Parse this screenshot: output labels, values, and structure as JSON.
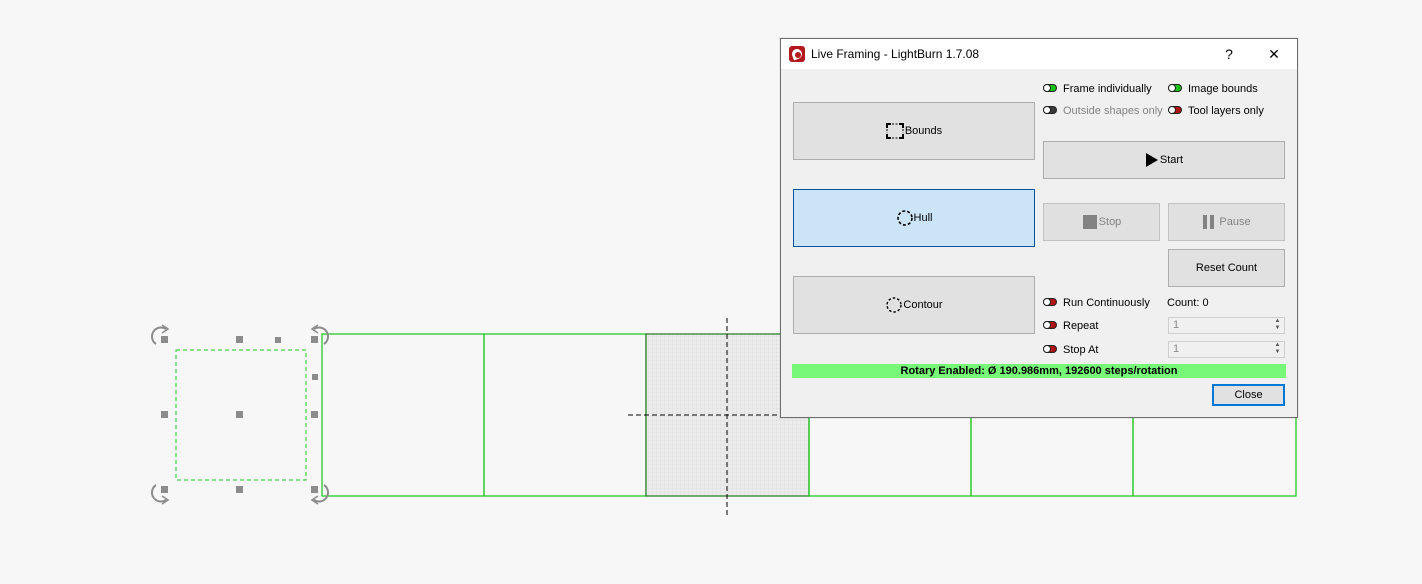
{
  "window": {
    "title": "Live Framing - LightBurn 1.7.08",
    "help_label": "?",
    "close_label": "✕"
  },
  "modes": [
    {
      "label": "Bounds",
      "icon": "bounds-icon",
      "selected": false
    },
    {
      "label": "Hull",
      "icon": "hull-icon",
      "selected": true
    },
    {
      "label": "Contour",
      "icon": "contour-icon",
      "selected": false
    }
  ],
  "options": {
    "frame_individually": {
      "label": "Frame individually",
      "state": "on"
    },
    "image_bounds": {
      "label": "Image bounds",
      "state": "on"
    },
    "outside_shapes_only": {
      "label": "Outside shapes only",
      "state": "off",
      "disabled": true
    },
    "tool_layers_only": {
      "label": "Tool layers only",
      "state": "off"
    }
  },
  "controls": {
    "start_label": "Start",
    "stop_label": "Stop",
    "pause_label": "Pause",
    "reset_count_label": "Reset Count",
    "run_continuously_label": "Run Continuously",
    "count_label": "Count: 0",
    "repeat_label": "Repeat",
    "repeat_value": "1",
    "stop_at_label": "Stop At",
    "stop_at_value": "1",
    "close_label": "Close"
  },
  "status": {
    "rotary_text": "Rotary Enabled: Ø 190.986mm, 192600 steps/rotation"
  },
  "colors": {
    "canvas_bg": "#f7f7f7",
    "shape_green": "#18c818",
    "handle_gray": "#8c8c8c",
    "toggle_on": "#14c314",
    "toggle_off": "#b01414",
    "status_bar": "#78f878",
    "selected_button": "#cce4f7"
  }
}
